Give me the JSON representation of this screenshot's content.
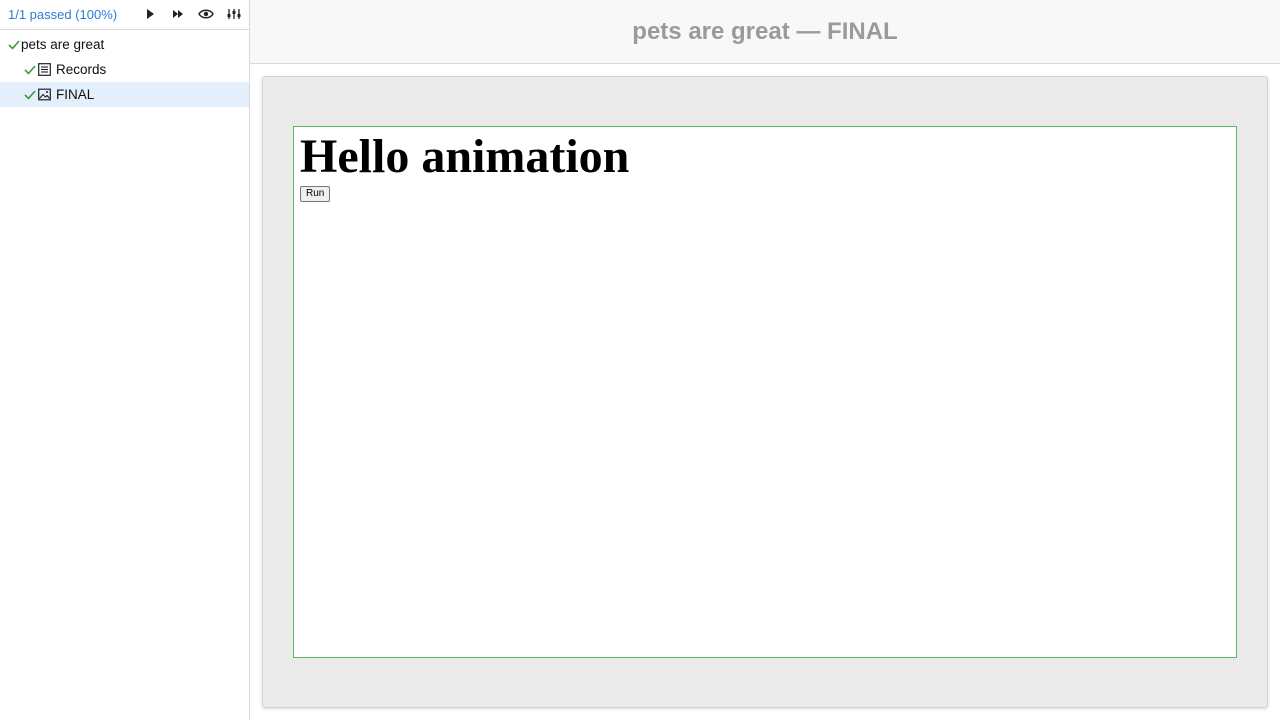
{
  "sidebar": {
    "summary": "1/1 passed (100%)",
    "toolbar_icons": [
      "play-icon",
      "fast-forward-icon",
      "eye-icon",
      "sliders-icon"
    ],
    "tree": [
      {
        "label": "pets are great",
        "status": "passed",
        "level": 0
      },
      {
        "label": "Records",
        "status": "passed",
        "level": 1,
        "icon": "list-icon"
      },
      {
        "label": "FINAL",
        "status": "passed",
        "level": 1,
        "icon": "image-icon",
        "selected": true
      }
    ]
  },
  "header": {
    "title": "pets are great — FINAL"
  },
  "preview": {
    "heading": "Hello animation",
    "run_button": "Run"
  },
  "colors": {
    "accent": "#2f7bd6",
    "pass": "#3a9a3a",
    "selected_row": "#e3f0fc",
    "frame_border": "#5cb85c"
  }
}
